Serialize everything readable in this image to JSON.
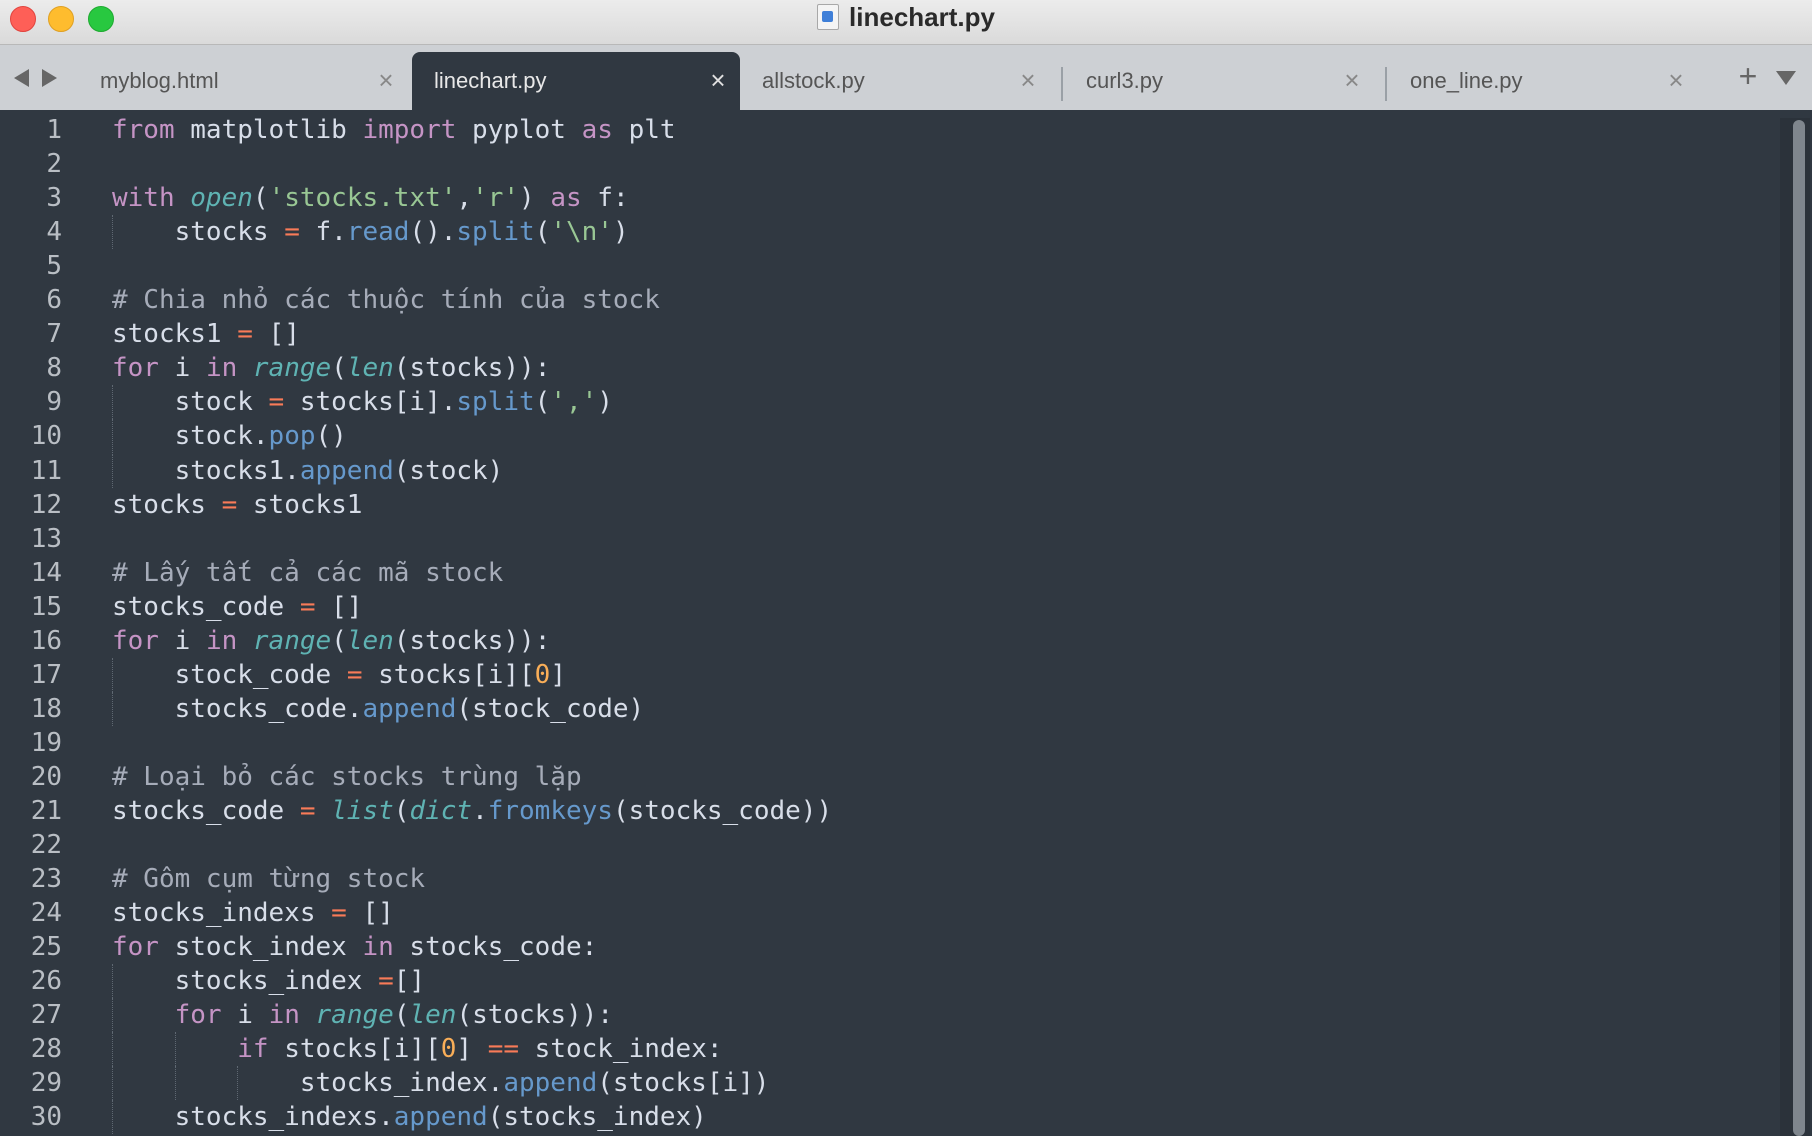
{
  "window": {
    "title": "linechart.py",
    "traffic_lights": [
      "close",
      "minimize",
      "maximize"
    ]
  },
  "tabs": [
    {
      "label": "myblog.html",
      "active": false
    },
    {
      "label": "linechart.py",
      "active": true
    },
    {
      "label": "allstock.py",
      "active": false
    },
    {
      "label": "curl3.py",
      "active": false
    },
    {
      "label": "one_line.py",
      "active": false
    }
  ],
  "tab_close_glyph": "×",
  "tab_add_glyph": "+",
  "editor": {
    "theme_background": "#303841",
    "lines": [
      [
        [
          "kw",
          "from"
        ],
        [
          "pl",
          " matplotlib "
        ],
        [
          "kw",
          "import"
        ],
        [
          "pl",
          " pyplot "
        ],
        [
          "kw",
          "as"
        ],
        [
          "pl",
          " plt"
        ]
      ],
      [],
      [
        [
          "kw",
          "with"
        ],
        [
          "pl",
          " "
        ],
        [
          "bi",
          "open"
        ],
        [
          "pl",
          "("
        ],
        [
          "str",
          "'stocks.txt'"
        ],
        [
          "pl",
          ","
        ],
        [
          "str",
          "'r'"
        ],
        [
          "pl",
          ") "
        ],
        [
          "kw",
          "as"
        ],
        [
          "pl",
          " f:"
        ]
      ],
      [
        [
          "pl",
          "    stocks "
        ],
        [
          "op",
          "="
        ],
        [
          "pl",
          " f."
        ],
        [
          "fn",
          "read"
        ],
        [
          "pl",
          "()."
        ],
        [
          "fn",
          "split"
        ],
        [
          "pl",
          "("
        ],
        [
          "str",
          "'\\n'"
        ],
        [
          "pl",
          ")"
        ]
      ],
      [],
      [
        [
          "cmt",
          "# Chia nhỏ các thuộc tính của stock"
        ]
      ],
      [
        [
          "pl",
          "stocks1 "
        ],
        [
          "op",
          "="
        ],
        [
          "pl",
          " []"
        ]
      ],
      [
        [
          "kw",
          "for"
        ],
        [
          "pl",
          " i "
        ],
        [
          "kw",
          "in"
        ],
        [
          "pl",
          " "
        ],
        [
          "bi",
          "range"
        ],
        [
          "pl",
          "("
        ],
        [
          "bi",
          "len"
        ],
        [
          "pl",
          "(stocks)):"
        ]
      ],
      [
        [
          "pl",
          "    stock "
        ],
        [
          "op",
          "="
        ],
        [
          "pl",
          " stocks[i]."
        ],
        [
          "fn",
          "split"
        ],
        [
          "pl",
          "("
        ],
        [
          "str",
          "','"
        ],
        [
          "pl",
          ")"
        ]
      ],
      [
        [
          "pl",
          "    stock."
        ],
        [
          "fn",
          "pop"
        ],
        [
          "pl",
          "()"
        ]
      ],
      [
        [
          "pl",
          "    stocks1."
        ],
        [
          "fn",
          "append"
        ],
        [
          "pl",
          "(stock)"
        ]
      ],
      [
        [
          "pl",
          "stocks "
        ],
        [
          "op",
          "="
        ],
        [
          "pl",
          " stocks1"
        ]
      ],
      [],
      [
        [
          "cmt",
          "# Lấy tất cả các mã stock"
        ]
      ],
      [
        [
          "pl",
          "stocks_code "
        ],
        [
          "op",
          "="
        ],
        [
          "pl",
          " []"
        ]
      ],
      [
        [
          "kw",
          "for"
        ],
        [
          "pl",
          " i "
        ],
        [
          "kw",
          "in"
        ],
        [
          "pl",
          " "
        ],
        [
          "bi",
          "range"
        ],
        [
          "pl",
          "("
        ],
        [
          "bi",
          "len"
        ],
        [
          "pl",
          "(stocks)):"
        ]
      ],
      [
        [
          "pl",
          "    stock_code "
        ],
        [
          "op",
          "="
        ],
        [
          "pl",
          " stocks[i]["
        ],
        [
          "num",
          "0"
        ],
        [
          "pl",
          "]"
        ]
      ],
      [
        [
          "pl",
          "    stocks_code."
        ],
        [
          "fn",
          "append"
        ],
        [
          "pl",
          "(stock_code)"
        ]
      ],
      [],
      [
        [
          "cmt",
          "# Loại bỏ các stocks trùng lặp"
        ]
      ],
      [
        [
          "pl",
          "stocks_code "
        ],
        [
          "op",
          "="
        ],
        [
          "pl",
          " "
        ],
        [
          "bi",
          "list"
        ],
        [
          "pl",
          "("
        ],
        [
          "bi",
          "dict"
        ],
        [
          "pl",
          "."
        ],
        [
          "fn",
          "fromkeys"
        ],
        [
          "pl",
          "(stocks_code))"
        ]
      ],
      [],
      [
        [
          "cmt",
          "# Gôm cụm từng stock"
        ]
      ],
      [
        [
          "pl",
          "stocks_indexs "
        ],
        [
          "op",
          "="
        ],
        [
          "pl",
          " []"
        ]
      ],
      [
        [
          "kw",
          "for"
        ],
        [
          "pl",
          " stock_index "
        ],
        [
          "kw",
          "in"
        ],
        [
          "pl",
          " stocks_code:"
        ]
      ],
      [
        [
          "pl",
          "    stocks_index "
        ],
        [
          "op",
          "="
        ],
        [
          "pl",
          "[]"
        ]
      ],
      [
        [
          "pl",
          "    "
        ],
        [
          "kw",
          "for"
        ],
        [
          "pl",
          " i "
        ],
        [
          "kw",
          "in"
        ],
        [
          "pl",
          " "
        ],
        [
          "bi",
          "range"
        ],
        [
          "pl",
          "("
        ],
        [
          "bi",
          "len"
        ],
        [
          "pl",
          "(stocks)):"
        ]
      ],
      [
        [
          "pl",
          "        "
        ],
        [
          "kw",
          "if"
        ],
        [
          "pl",
          " stocks[i]["
        ],
        [
          "num",
          "0"
        ],
        [
          "pl",
          "] "
        ],
        [
          "op",
          "=="
        ],
        [
          "pl",
          " stock_index:"
        ]
      ],
      [
        [
          "pl",
          "            stocks_index."
        ],
        [
          "fn",
          "append"
        ],
        [
          "pl",
          "(stocks[i])"
        ]
      ],
      [
        [
          "pl",
          "    stocks_indexs."
        ],
        [
          "fn",
          "append"
        ],
        [
          "pl",
          "(stocks_index)"
        ]
      ]
    ],
    "line_numbers": [
      "1",
      "2",
      "3",
      "4",
      "5",
      "6",
      "7",
      "8",
      "9",
      "10",
      "11",
      "12",
      "13",
      "14",
      "15",
      "16",
      "17",
      "18",
      "19",
      "20",
      "21",
      "22",
      "23",
      "24",
      "25",
      "26",
      "27",
      "28",
      "29",
      "30"
    ]
  }
}
